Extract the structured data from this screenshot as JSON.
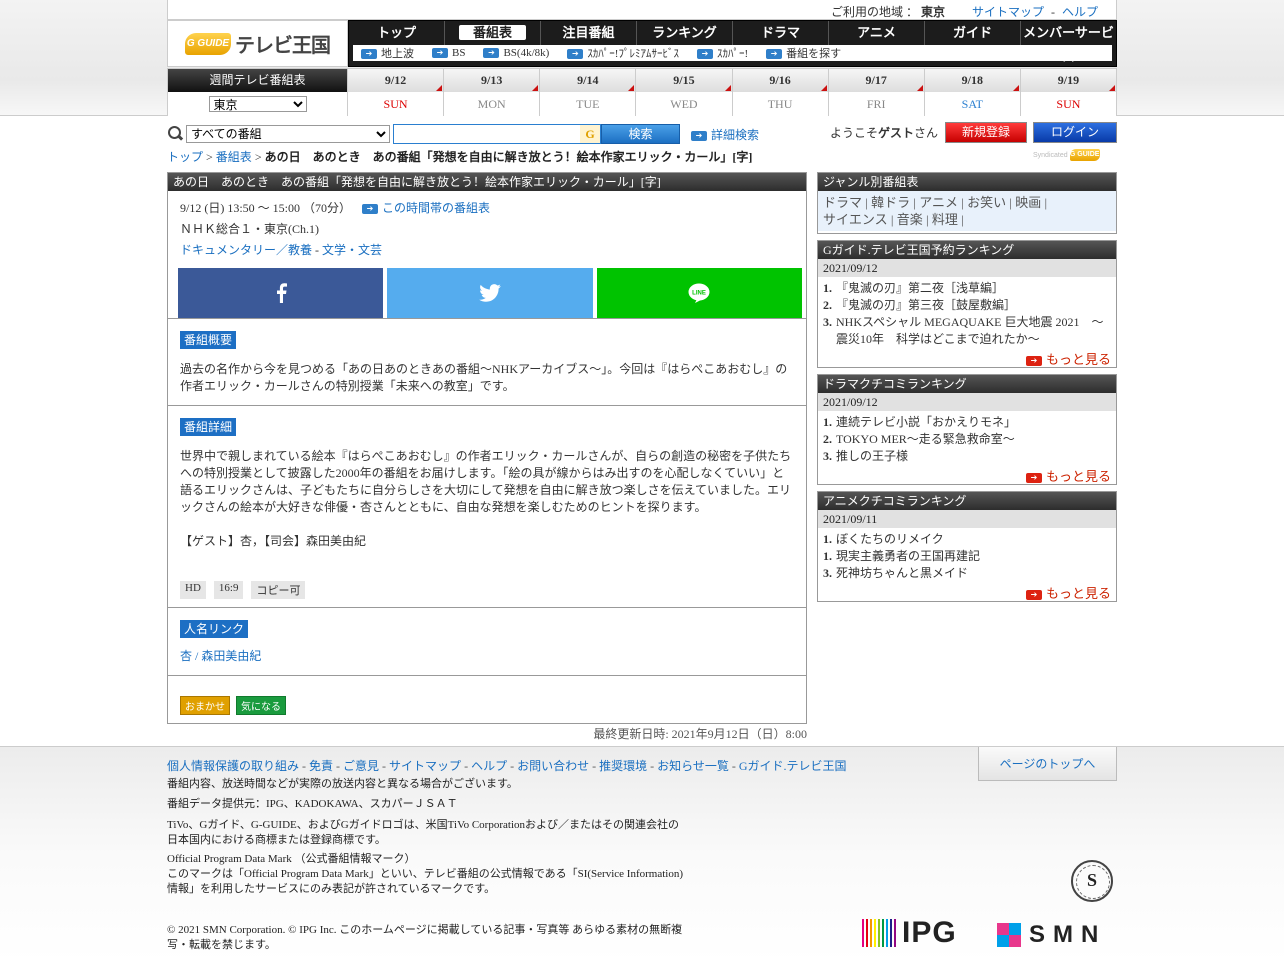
{
  "utility": {
    "region_label": "ご利用の地域 ：",
    "region": "東京",
    "sitemap": "サイトマップ",
    "help": "ヘルプ"
  },
  "logo": {
    "badge": "G GUIDE",
    "name": "テレビ王国"
  },
  "nav": {
    "tabs": [
      "トップ",
      "番組表",
      "注目番組",
      "ランキング",
      "ドラマ",
      "アニメ",
      "ガイド",
      "メンバーサービス"
    ],
    "active_tab": "番組表",
    "sub": [
      "地上波",
      "BS",
      "BS(4k/8k)",
      "ｽｶﾊﾟｰ!ﾌﾟﾚﾐｱﾑｻｰﾋﾞｽ",
      "ｽｶﾊﾟｰ!",
      "番組を探す"
    ]
  },
  "schedule": {
    "title": "週間テレビ番組表",
    "area_select": "東京",
    "days": [
      {
        "date": "9/12",
        "dow": "SUN"
      },
      {
        "date": "9/13",
        "dow": "MON"
      },
      {
        "date": "9/14",
        "dow": "TUE"
      },
      {
        "date": "9/15",
        "dow": "WED"
      },
      {
        "date": "9/16",
        "dow": "THU"
      },
      {
        "date": "9/17",
        "dow": "FRI"
      },
      {
        "date": "9/18",
        "dow": "SAT"
      },
      {
        "date": "9/19",
        "dow": "SUN"
      }
    ]
  },
  "search": {
    "category": "すべての番組",
    "button": "検索",
    "advanced": "詳細検索",
    "keyword_icon": "G"
  },
  "account": {
    "welcome_prefix": "ようこそ",
    "guest": "ゲスト",
    "welcome_suffix": "さん",
    "register": "新規登録",
    "login": "ログイン"
  },
  "breadcrumb": {
    "top": "トップ",
    "schedule": "番組表",
    "current": "あの日　あのとき　あの番組「発想を自由に解き放とう！絵本作家エリック・カール」[字]"
  },
  "syndicated": {
    "text": "Syndicated",
    "badge": "G GUIDE"
  },
  "program": {
    "title": "あの日　あのとき　あの番組「発想を自由に解き放とう！絵本作家エリック・カール」[字]",
    "datetime": "9/12 (日) 13:50 ～ 15:00 （70分）",
    "timeslot_link": "この時間帯の番組表",
    "channel": "ＮＨＫ総合１・東京(Ch.1)",
    "genre1": "ドキュメンタリー／教養",
    "genre_sep": " - ",
    "genre2": "文学・文芸",
    "summary_label": "番組概要",
    "summary": "過去の名作から今を見つめる「あの日あのときあの番組～NHKアーカイブス～」。今回は『はらぺこあおむし』の作者エリック・カールさんの特別授業「未来への教室」です。",
    "detail_label": "番組詳細",
    "detail": "世界中で親しまれている絵本『はらぺこあおむし』の作者エリック・カールさんが、自らの創造の秘密を子供たちへの特別授業として披露した2000年の番組をお届けします。「絵の具が線からはみ出すのを心配しなくていい」と語るエリックさんは、子どもたちに自分らしさを大切にして発想を自由に解き放つ楽しさを伝えていました。エリックさんの絵本が大好きな俳優・杏さんとともに、自由な発想を楽しむためのヒントを探ります。",
    "cast": "【ゲスト】杏，【司会】森田美由紀",
    "tags": [
      "HD",
      "16:9",
      "コピー可"
    ],
    "people_label": "人名リンク",
    "person1": "杏",
    "person_sep": " / ",
    "person2": "森田美由紀",
    "omakase": "おまかせ",
    "kininaru": "気になる",
    "updated": "最終更新日時: 2021年9月12日（日）8:00"
  },
  "sidebar": {
    "genre": {
      "title": "ジャンル別番組表",
      "items": [
        "ドラマ",
        "韓ドラ",
        "アニメ",
        "お笑い",
        "映画",
        "サイエンス",
        "音楽",
        "料理"
      ]
    },
    "reservation": {
      "title": "Gガイド.テレビ王国予約ランキング",
      "date": "2021/09/12",
      "items": [
        {
          "rank": "1.",
          "title": "『鬼滅の刃』第二夜［浅草編］"
        },
        {
          "rank": "2.",
          "title": "『鬼滅の刃』第三夜［鼓屋敷編］"
        },
        {
          "rank": "3.",
          "title": "NHKスペシャル MEGAQUAKE 巨大地震 2021　〜震災10年　科学はどこまで迫れたか〜"
        }
      ],
      "more": "もっと見る"
    },
    "drama": {
      "title": "ドラマクチコミランキング",
      "date": "2021/09/12",
      "items": [
        {
          "rank": "1.",
          "title": "連続テレビ小説「おかえりモネ」"
        },
        {
          "rank": "2.",
          "title": "TOKYO MER～走る緊急救命室～"
        },
        {
          "rank": "3.",
          "title": "推しの王子様"
        }
      ],
      "more": "もっと見る"
    },
    "anime": {
      "title": "アニメクチコミランキング",
      "date": "2021/09/11",
      "items": [
        {
          "rank": "1.",
          "title": "ぼくたちのリメイク"
        },
        {
          "rank": "1.",
          "title": "現実主義勇者の王国再建記"
        },
        {
          "rank": "3.",
          "title": "死神坊ちゃんと黒メイド"
        }
      ],
      "more": "もっと見る"
    }
  },
  "footer": {
    "links": [
      "個人情報保護の取り組み",
      "免責",
      "ご意見",
      "サイトマップ",
      "ヘルプ",
      "お問い合わせ",
      "推奨環境",
      "お知らせ一覧",
      "Gガイド.テレビ王国"
    ],
    "to_top": "ページのトップへ",
    "note1": "番組内容、放送時間などが実際の放送内容と異なる場合がございます。",
    "note2": "番組データ提供元：IPG、KADOKAWA、スカパーＪＳＡＴ",
    "note3a": "TiVo、Gガイド、G-GUIDE、およびGガイドロゴは、米国TiVo Corporationおよび／またはその関連会社の",
    "note3b": "日本国内における商標または登録商標です。",
    "note4a": "Official Program Data Mark （公式番組情報マーク）",
    "note4b": "このマークは「Official Program Data Mark」といい、テレビ番組の公式情報である「SI(Service Information)",
    "note4c": "情報」を利用したサービスにのみ表記が許されているマークです。",
    "copy_a": "© 2021 SMN Corporation. © IPG Inc. このホームページに掲載している記事・写真等 あらゆる素材の無断複",
    "copy_b": "写・転載を禁じます。",
    "seal_letter": "S",
    "ipg": "IPG",
    "smn": "SMN"
  },
  "colors": {
    "accent": "#1a6fc0",
    "label_blue": "#1d6fc4",
    "red": "#d21111",
    "header_dark": "#2d2d2d"
  }
}
